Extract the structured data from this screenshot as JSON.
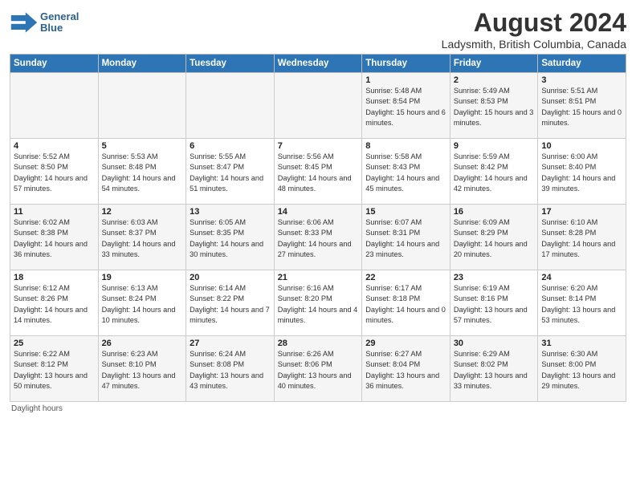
{
  "header": {
    "logo_line1": "General",
    "logo_line2": "Blue",
    "title": "August 2024",
    "location": "Ladysmith, British Columbia, Canada"
  },
  "weekdays": [
    "Sunday",
    "Monday",
    "Tuesday",
    "Wednesday",
    "Thursday",
    "Friday",
    "Saturday"
  ],
  "footer": "Daylight hours",
  "weeks": [
    [
      {
        "day": "",
        "info": ""
      },
      {
        "day": "",
        "info": ""
      },
      {
        "day": "",
        "info": ""
      },
      {
        "day": "",
        "info": ""
      },
      {
        "day": "1",
        "info": "Sunrise: 5:48 AM\nSunset: 8:54 PM\nDaylight: 15 hours\nand 6 minutes."
      },
      {
        "day": "2",
        "info": "Sunrise: 5:49 AM\nSunset: 8:53 PM\nDaylight: 15 hours\nand 3 minutes."
      },
      {
        "day": "3",
        "info": "Sunrise: 5:51 AM\nSunset: 8:51 PM\nDaylight: 15 hours\nand 0 minutes."
      }
    ],
    [
      {
        "day": "4",
        "info": "Sunrise: 5:52 AM\nSunset: 8:50 PM\nDaylight: 14 hours\nand 57 minutes."
      },
      {
        "day": "5",
        "info": "Sunrise: 5:53 AM\nSunset: 8:48 PM\nDaylight: 14 hours\nand 54 minutes."
      },
      {
        "day": "6",
        "info": "Sunrise: 5:55 AM\nSunset: 8:47 PM\nDaylight: 14 hours\nand 51 minutes."
      },
      {
        "day": "7",
        "info": "Sunrise: 5:56 AM\nSunset: 8:45 PM\nDaylight: 14 hours\nand 48 minutes."
      },
      {
        "day": "8",
        "info": "Sunrise: 5:58 AM\nSunset: 8:43 PM\nDaylight: 14 hours\nand 45 minutes."
      },
      {
        "day": "9",
        "info": "Sunrise: 5:59 AM\nSunset: 8:42 PM\nDaylight: 14 hours\nand 42 minutes."
      },
      {
        "day": "10",
        "info": "Sunrise: 6:00 AM\nSunset: 8:40 PM\nDaylight: 14 hours\nand 39 minutes."
      }
    ],
    [
      {
        "day": "11",
        "info": "Sunrise: 6:02 AM\nSunset: 8:38 PM\nDaylight: 14 hours\nand 36 minutes."
      },
      {
        "day": "12",
        "info": "Sunrise: 6:03 AM\nSunset: 8:37 PM\nDaylight: 14 hours\nand 33 minutes."
      },
      {
        "day": "13",
        "info": "Sunrise: 6:05 AM\nSunset: 8:35 PM\nDaylight: 14 hours\nand 30 minutes."
      },
      {
        "day": "14",
        "info": "Sunrise: 6:06 AM\nSunset: 8:33 PM\nDaylight: 14 hours\nand 27 minutes."
      },
      {
        "day": "15",
        "info": "Sunrise: 6:07 AM\nSunset: 8:31 PM\nDaylight: 14 hours\nand 23 minutes."
      },
      {
        "day": "16",
        "info": "Sunrise: 6:09 AM\nSunset: 8:29 PM\nDaylight: 14 hours\nand 20 minutes."
      },
      {
        "day": "17",
        "info": "Sunrise: 6:10 AM\nSunset: 8:28 PM\nDaylight: 14 hours\nand 17 minutes."
      }
    ],
    [
      {
        "day": "18",
        "info": "Sunrise: 6:12 AM\nSunset: 8:26 PM\nDaylight: 14 hours\nand 14 minutes."
      },
      {
        "day": "19",
        "info": "Sunrise: 6:13 AM\nSunset: 8:24 PM\nDaylight: 14 hours\nand 10 minutes."
      },
      {
        "day": "20",
        "info": "Sunrise: 6:14 AM\nSunset: 8:22 PM\nDaylight: 14 hours\nand 7 minutes."
      },
      {
        "day": "21",
        "info": "Sunrise: 6:16 AM\nSunset: 8:20 PM\nDaylight: 14 hours\nand 4 minutes."
      },
      {
        "day": "22",
        "info": "Sunrise: 6:17 AM\nSunset: 8:18 PM\nDaylight: 14 hours\nand 0 minutes."
      },
      {
        "day": "23",
        "info": "Sunrise: 6:19 AM\nSunset: 8:16 PM\nDaylight: 13 hours\nand 57 minutes."
      },
      {
        "day": "24",
        "info": "Sunrise: 6:20 AM\nSunset: 8:14 PM\nDaylight: 13 hours\nand 53 minutes."
      }
    ],
    [
      {
        "day": "25",
        "info": "Sunrise: 6:22 AM\nSunset: 8:12 PM\nDaylight: 13 hours\nand 50 minutes."
      },
      {
        "day": "26",
        "info": "Sunrise: 6:23 AM\nSunset: 8:10 PM\nDaylight: 13 hours\nand 47 minutes."
      },
      {
        "day": "27",
        "info": "Sunrise: 6:24 AM\nSunset: 8:08 PM\nDaylight: 13 hours\nand 43 minutes."
      },
      {
        "day": "28",
        "info": "Sunrise: 6:26 AM\nSunset: 8:06 PM\nDaylight: 13 hours\nand 40 minutes."
      },
      {
        "day": "29",
        "info": "Sunrise: 6:27 AM\nSunset: 8:04 PM\nDaylight: 13 hours\nand 36 minutes."
      },
      {
        "day": "30",
        "info": "Sunrise: 6:29 AM\nSunset: 8:02 PM\nDaylight: 13 hours\nand 33 minutes."
      },
      {
        "day": "31",
        "info": "Sunrise: 6:30 AM\nSunset: 8:00 PM\nDaylight: 13 hours\nand 29 minutes."
      }
    ]
  ]
}
